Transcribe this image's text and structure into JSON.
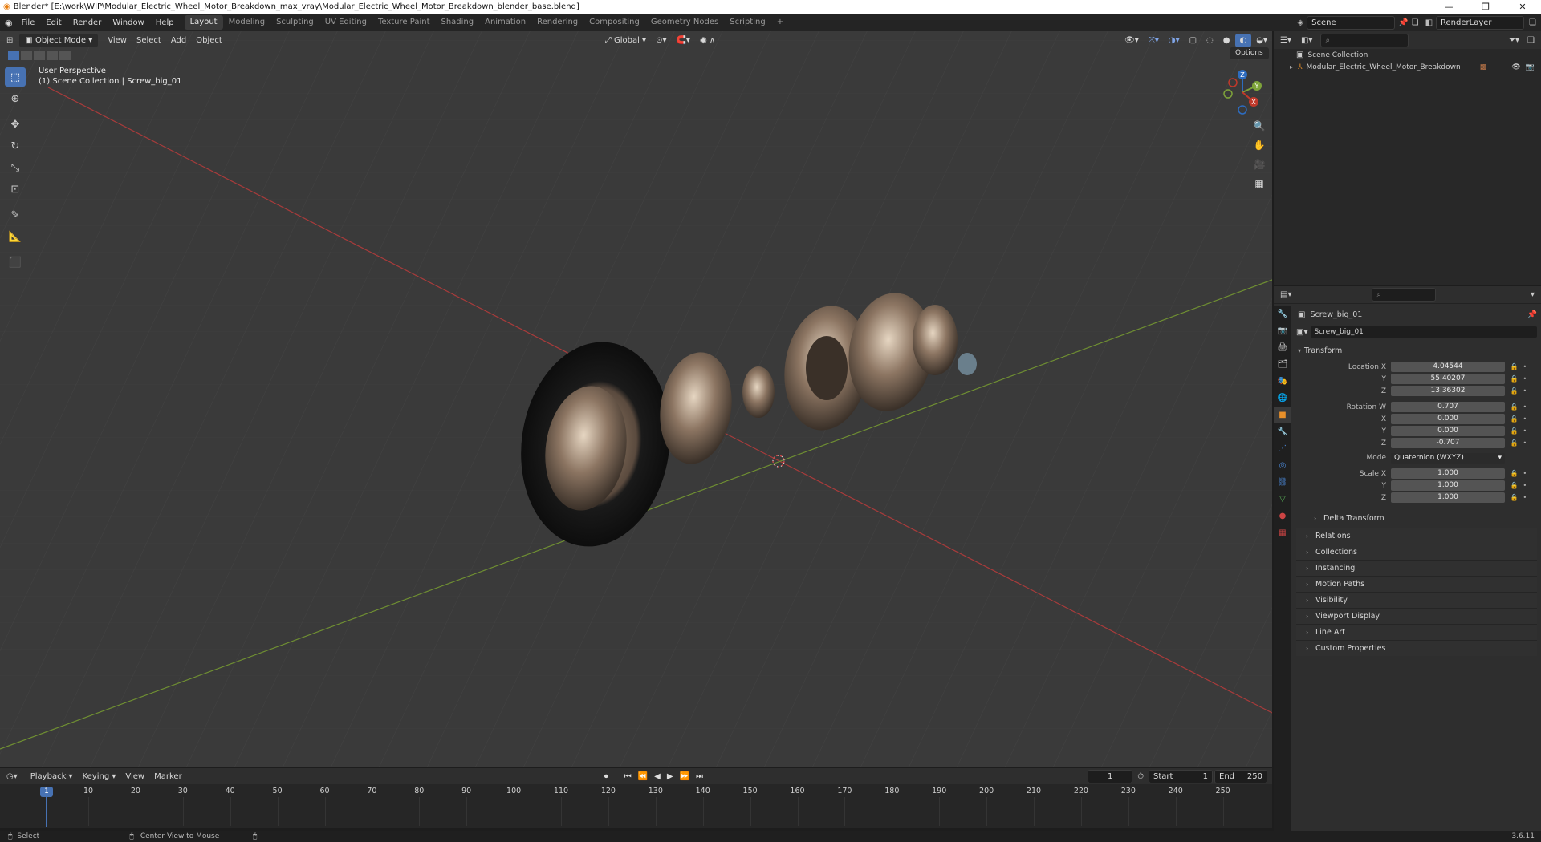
{
  "window": {
    "title": "Blender* [E:\\work\\WIP\\Modular_Electric_Wheel_Motor_Breakdown_max_vray\\Modular_Electric_Wheel_Motor_Breakdown_blender_base.blend]",
    "minimize": "—",
    "maximize": "❐",
    "close": "✕"
  },
  "menu": [
    "File",
    "Edit",
    "Render",
    "Window",
    "Help"
  ],
  "workspaces": [
    "Layout",
    "Modeling",
    "Sculpting",
    "UV Editing",
    "Texture Paint",
    "Shading",
    "Animation",
    "Rendering",
    "Compositing",
    "Geometry Nodes",
    "Scripting"
  ],
  "active_workspace": "Layout",
  "add_workspace": "+",
  "scene": {
    "label": "Scene",
    "render_layer": "RenderLayer"
  },
  "viewport": {
    "mode": "Object Mode",
    "menus": [
      "View",
      "Select",
      "Add",
      "Object"
    ],
    "orientation": "Global",
    "options": "Options",
    "perspective": "User Perspective",
    "context": "(1) Scene Collection | Screw_big_01",
    "gizmo": {
      "x": "X",
      "y": "Y",
      "z": "Z"
    }
  },
  "outliner": {
    "root": "Scene Collection",
    "items": [
      {
        "label": "Modular_Electric_Wheel_Motor_Breakdown"
      }
    ]
  },
  "properties": {
    "object_name": "Screw_big_01",
    "data_name": "Screw_big_01",
    "transform_label": "Transform",
    "location": {
      "label": "Location X",
      "x": "4.04544",
      "y_label": "Y",
      "y": "55.40207",
      "z_label": "Z",
      "z": "13.36302"
    },
    "rotation": {
      "label": "Rotation W",
      "w": "0.707",
      "x_label": "X",
      "x": "0.000",
      "y_label": "Y",
      "y": "0.000",
      "z_label": "Z",
      "z": "-0.707"
    },
    "mode": {
      "label": "Mode",
      "value": "Quaternion (WXYZ)"
    },
    "scale": {
      "label": "Scale X",
      "x": "1.000",
      "y_label": "Y",
      "y": "1.000",
      "z_label": "Z",
      "z": "1.000"
    },
    "delta": "Delta Transform",
    "panels": [
      "Relations",
      "Collections",
      "Instancing",
      "Motion Paths",
      "Visibility",
      "Viewport Display",
      "Line Art",
      "Custom Properties"
    ]
  },
  "timeline": {
    "menus": [
      "Playback",
      "Keying",
      "View",
      "Marker"
    ],
    "current_frame": "1",
    "start_label": "Start",
    "start": "1",
    "end_label": "End",
    "end": "250",
    "ticks": [
      "10",
      "20",
      "30",
      "40",
      "50",
      "60",
      "70",
      "80",
      "90",
      "100",
      "110",
      "120",
      "130",
      "140",
      "150",
      "160",
      "170",
      "180",
      "190",
      "200",
      "210",
      "220",
      "230",
      "240",
      "250"
    ]
  },
  "status": {
    "left": "Select",
    "middle": "Center View to Mouse",
    "version": "3.6.11"
  },
  "colors": {
    "accent": "#4772b3",
    "x_axis": "#c0392b",
    "y_axis": "#7ea33a",
    "z_axis": "#2d6cc0",
    "active_frame": "#4772b3"
  }
}
